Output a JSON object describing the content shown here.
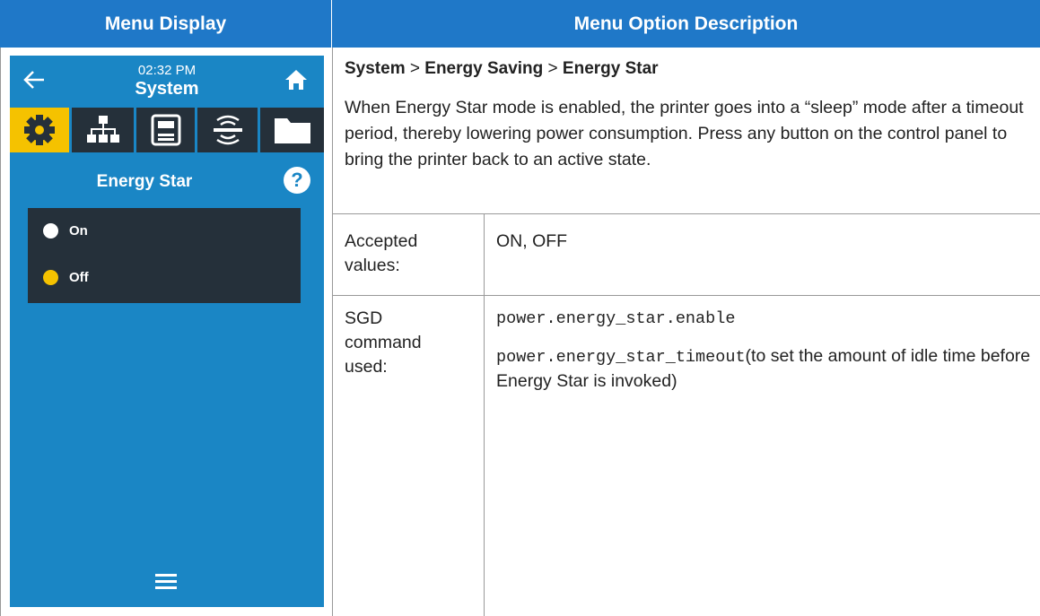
{
  "headers": {
    "left": "Menu Display",
    "right": "Menu Option Description"
  },
  "device": {
    "time": "02:32 PM",
    "title": "System",
    "sub_title": "Energy Star",
    "help": "?",
    "options": [
      {
        "label": "On",
        "selected": false
      },
      {
        "label": "Off",
        "selected": true
      }
    ],
    "colors": {
      "screen": "#1a86c5",
      "active_tab": "#f5c200",
      "panel": "#25303a"
    },
    "tab_icons": [
      "gear-icon",
      "network-icon",
      "printer-icon",
      "wireless-icon",
      "folder-icon"
    ]
  },
  "breadcrumb": {
    "a": "System",
    "sep1": " > ",
    "b": "Energy Saving",
    "sep2": " > ",
    "c": "Energy Star"
  },
  "description": "When Energy Star mode is enabled, the printer goes into a “sleep” mode after a timeout period, thereby lowering power consumption. Press any button on the control panel to bring the printer back to an active state.",
  "rows": {
    "accepted_label": "Accepted values:",
    "accepted_value": "ON, OFF",
    "sgd_label": "SGD command used:",
    "sgd_cmd1": "power.energy_star.enable",
    "sgd_cmd2": "power.energy_star_timeout",
    "sgd_cmd2_note": "(to set the amount of idle time before Energy Star is invoked)"
  }
}
